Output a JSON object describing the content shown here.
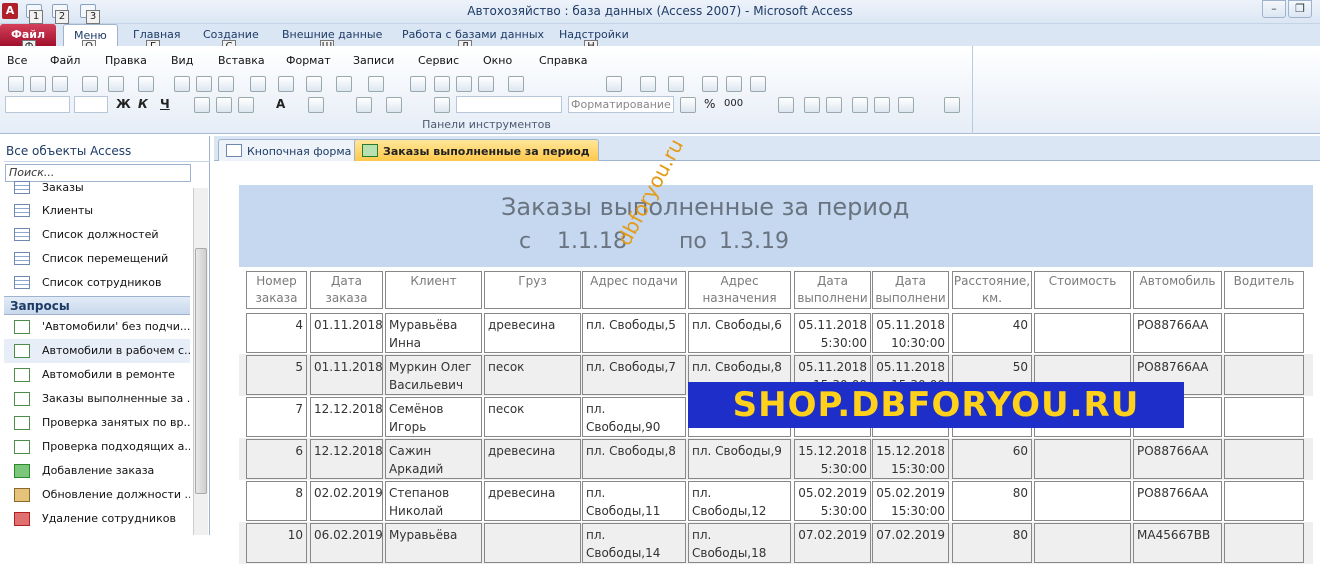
{
  "window": {
    "title": "Автохозяйство : база данных (Access 2007)  -  Microsoft Access",
    "app_icon": "A",
    "min": "–",
    "restore": "❐"
  },
  "keytips": {
    "qa1": "1",
    "qa2": "2",
    "qa3": "3",
    "file": "Ф",
    "menu": "Q",
    "home": "Г",
    "create": "С",
    "external": "Ш",
    "dbtools": "Л",
    "addins": "Н"
  },
  "ribbon_tabs": {
    "file": "Файл",
    "menu": "Меню",
    "home": "Главная",
    "create": "Создание",
    "external": "Внешние данные",
    "dbtools": "Работа с базами данных",
    "addins": "Надстройки"
  },
  "menus": [
    "Все",
    "Файл",
    "Правка",
    "Вид",
    "Вставка",
    "Формат",
    "Записи",
    "Сервис",
    "Окно",
    "Справка"
  ],
  "toolbar": {
    "bold": "Ж",
    "italic": "К",
    "underline": "Ч",
    "format_combo": "Форматирование",
    "group_label": "Панели инструментов",
    "percent": "%",
    "thousands": "000",
    "font_color": "A"
  },
  "nav": {
    "title": "Все объекты Access",
    "search_placeholder": "Поиск...",
    "items_tables": [
      "Заказы",
      "Клиенты",
      "Список должностей",
      "Список перемещений",
      "Список сотрудников"
    ],
    "group_queries": "Запросы",
    "items_queries": [
      "'Автомобили' без подчи...",
      "Автомобили в рабочем с...",
      "Автомобили в ремонте",
      "Заказы выполненные за ...",
      "Проверка занятых по вр...",
      "Проверка подходящих а...",
      "Добавление заказа",
      "Обновление должности ...",
      "Удаление сотрудников"
    ]
  },
  "doc_tabs": {
    "tab1": "Кнопочная форма",
    "tab2": "Заказы выполненные за период"
  },
  "report": {
    "title": "Заказы выполненные за период",
    "from_label": "с",
    "from_value": "1.1.18",
    "to_label": "по",
    "to_value": "1.3.19",
    "headers": [
      [
        "Номер",
        "заказа"
      ],
      [
        "Дата",
        "заказа"
      ],
      [
        "Клиент",
        ""
      ],
      [
        "Груз",
        ""
      ],
      [
        "Адрес подачи",
        ""
      ],
      [
        "Адрес",
        "назначения"
      ],
      [
        "Дата",
        "выполнени"
      ],
      [
        "Дата",
        "выполнени"
      ],
      [
        "Расстояние,",
        "км."
      ],
      [
        "Стоимость",
        ""
      ],
      [
        "Автомобиль",
        ""
      ],
      [
        "Водитель",
        ""
      ]
    ],
    "rows": [
      [
        "4",
        "01.11.2018",
        "Муравьёва Инна",
        "древесина",
        "пл. Свободы,5",
        "пл. Свободы,6",
        "05.11.2018 5:30:00",
        "05.11.2018 10:30:00",
        "40",
        "",
        "РО88766АА",
        ""
      ],
      [
        "5",
        "01.11.2018",
        "Муркин Олег Васильевич",
        "песок",
        "пл. Свободы,7",
        "пл. Свободы,8",
        "05.11.2018 15:30:00",
        "05.11.2018 15:30:00",
        "50",
        "",
        "РО88766АА",
        ""
      ],
      [
        "7",
        "12.12.2018",
        "Семёнов Игорь",
        "песок",
        "пл. Свободы,90",
        "",
        "5:30:00",
        "",
        "",
        "",
        "66АА",
        ""
      ],
      [
        "6",
        "12.12.2018",
        "Сажин Аркадий",
        "древесина",
        "пл. Свободы,8",
        "пл. Свободы,9",
        "15.12.2018 5:30:00",
        "15.12.2018 15:30:00",
        "60",
        "",
        "РО88766АА",
        ""
      ],
      [
        "8",
        "02.02.2019",
        "Степанов Николай",
        "древесина",
        "пл. Свободы,11",
        "пл. Свободы,12",
        "05.02.2019 5:30:00",
        "05.02.2019 15:30:00",
        "80",
        "",
        "РО88766АА",
        ""
      ],
      [
        "10",
        "06.02.2019",
        "Муравьёва",
        "",
        "пл. Свободы,14",
        "пл. Свободы,18",
        "07.02.2019",
        "07.02.2019",
        "80",
        "",
        "МА45667ВВ",
        ""
      ]
    ]
  },
  "watermarks": {
    "banner": "SHOP.DBFORYOU.RU",
    "diagonal": "dbforyou.ru"
  },
  "colors": {
    "report_header": "#c5d8ef",
    "banner_bg": "#1d2fc8",
    "banner_text": "#ffd11a",
    "active_tab": "#ffc84a",
    "file_tab": "#b0202a"
  }
}
